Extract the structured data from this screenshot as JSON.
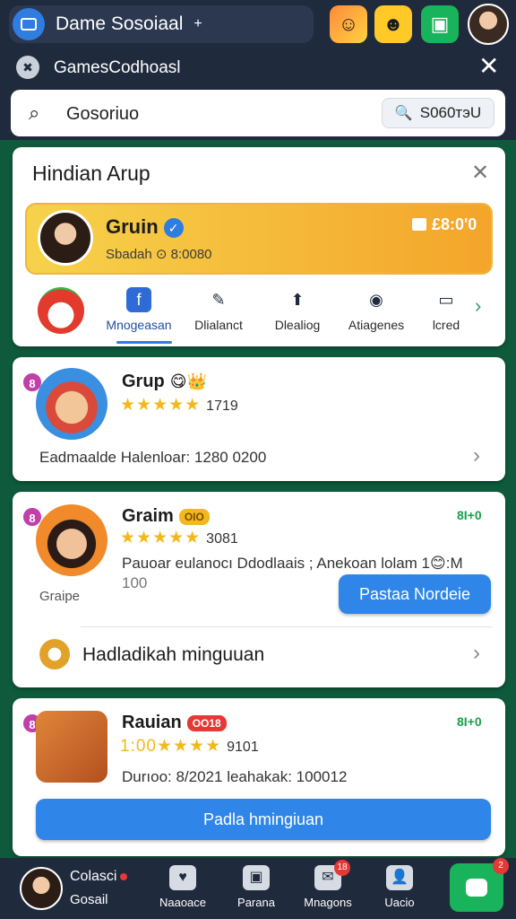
{
  "topbar": {
    "app_title": "Dame Sosoiaal",
    "plus": "+",
    "icons": [
      "face-icon",
      "emoji-icon",
      "camera-icon"
    ]
  },
  "subbar": {
    "title": "GamesCodhoasl",
    "close": "✕"
  },
  "search": {
    "value": "Gosoriuo",
    "button_label": "S060тэU"
  },
  "panel": {
    "title": "Hindian Arup",
    "close": "✕",
    "featured": {
      "name": "Gruin",
      "subtitle": "Sbadah ⊙ 8:0080",
      "price": "£8:0'0"
    },
    "tabs": [
      {
        "label": "Mnogeasan",
        "icon": "f",
        "active": true
      },
      {
        "label": "Dlialanct",
        "icon": "✎",
        "active": false
      },
      {
        "label": "Dlealiog",
        "icon": "⬆",
        "active": false
      },
      {
        "label": "Atiagenes",
        "icon": "◉",
        "active": false
      },
      {
        "label": "lcred",
        "icon": "▭",
        "active": false
      }
    ],
    "tab_arrow": "›"
  },
  "games": [
    {
      "badge": "8",
      "name": "Grup",
      "tag": "😋👑",
      "stars": "★★★★★",
      "rating": "1719",
      "description": "Eadmaalde Halenloar: 1280 0200",
      "arrow": "›"
    },
    {
      "badge": "8",
      "name": "Graim",
      "tag": "OIO",
      "stars": "★★★★★",
      "rating": "3081",
      "status": "8I+0",
      "description": "Pauoar eulanocı Ddodlaais ; Anekoan lolam 1😊:M",
      "description2": "100",
      "side_label": "Graipe",
      "button": "Pastaa Nordeie",
      "promo": "Hadladikah minguuan",
      "arrow": "›"
    },
    {
      "badge": "8",
      "name": "Rauian",
      "tag": "OO18",
      "stars": "1:00★★★★",
      "rating": "9101",
      "status": "8I+0",
      "description": "Durıoo: 8/2021 leahakak: 100012",
      "button": "Padla hmingiuan"
    }
  ],
  "bottom_nav": {
    "profile_name": "Colasci",
    "profile_sub": "Gosail",
    "items": [
      {
        "label": "Naaoace",
        "icon": "♥",
        "count": ""
      },
      {
        "label": "Parana",
        "icon": "▣",
        "count": ""
      },
      {
        "label": "Mnagons",
        "icon": "✉",
        "count": "18"
      },
      {
        "label": "Uacio",
        "icon": "👤",
        "count": ""
      }
    ],
    "cta_count": "2"
  },
  "colors": {
    "dark": "#1f2a3d",
    "green_bg": "#0f5a3d",
    "accent_blue": "#2f86e8",
    "gold": "#f4a52a"
  }
}
